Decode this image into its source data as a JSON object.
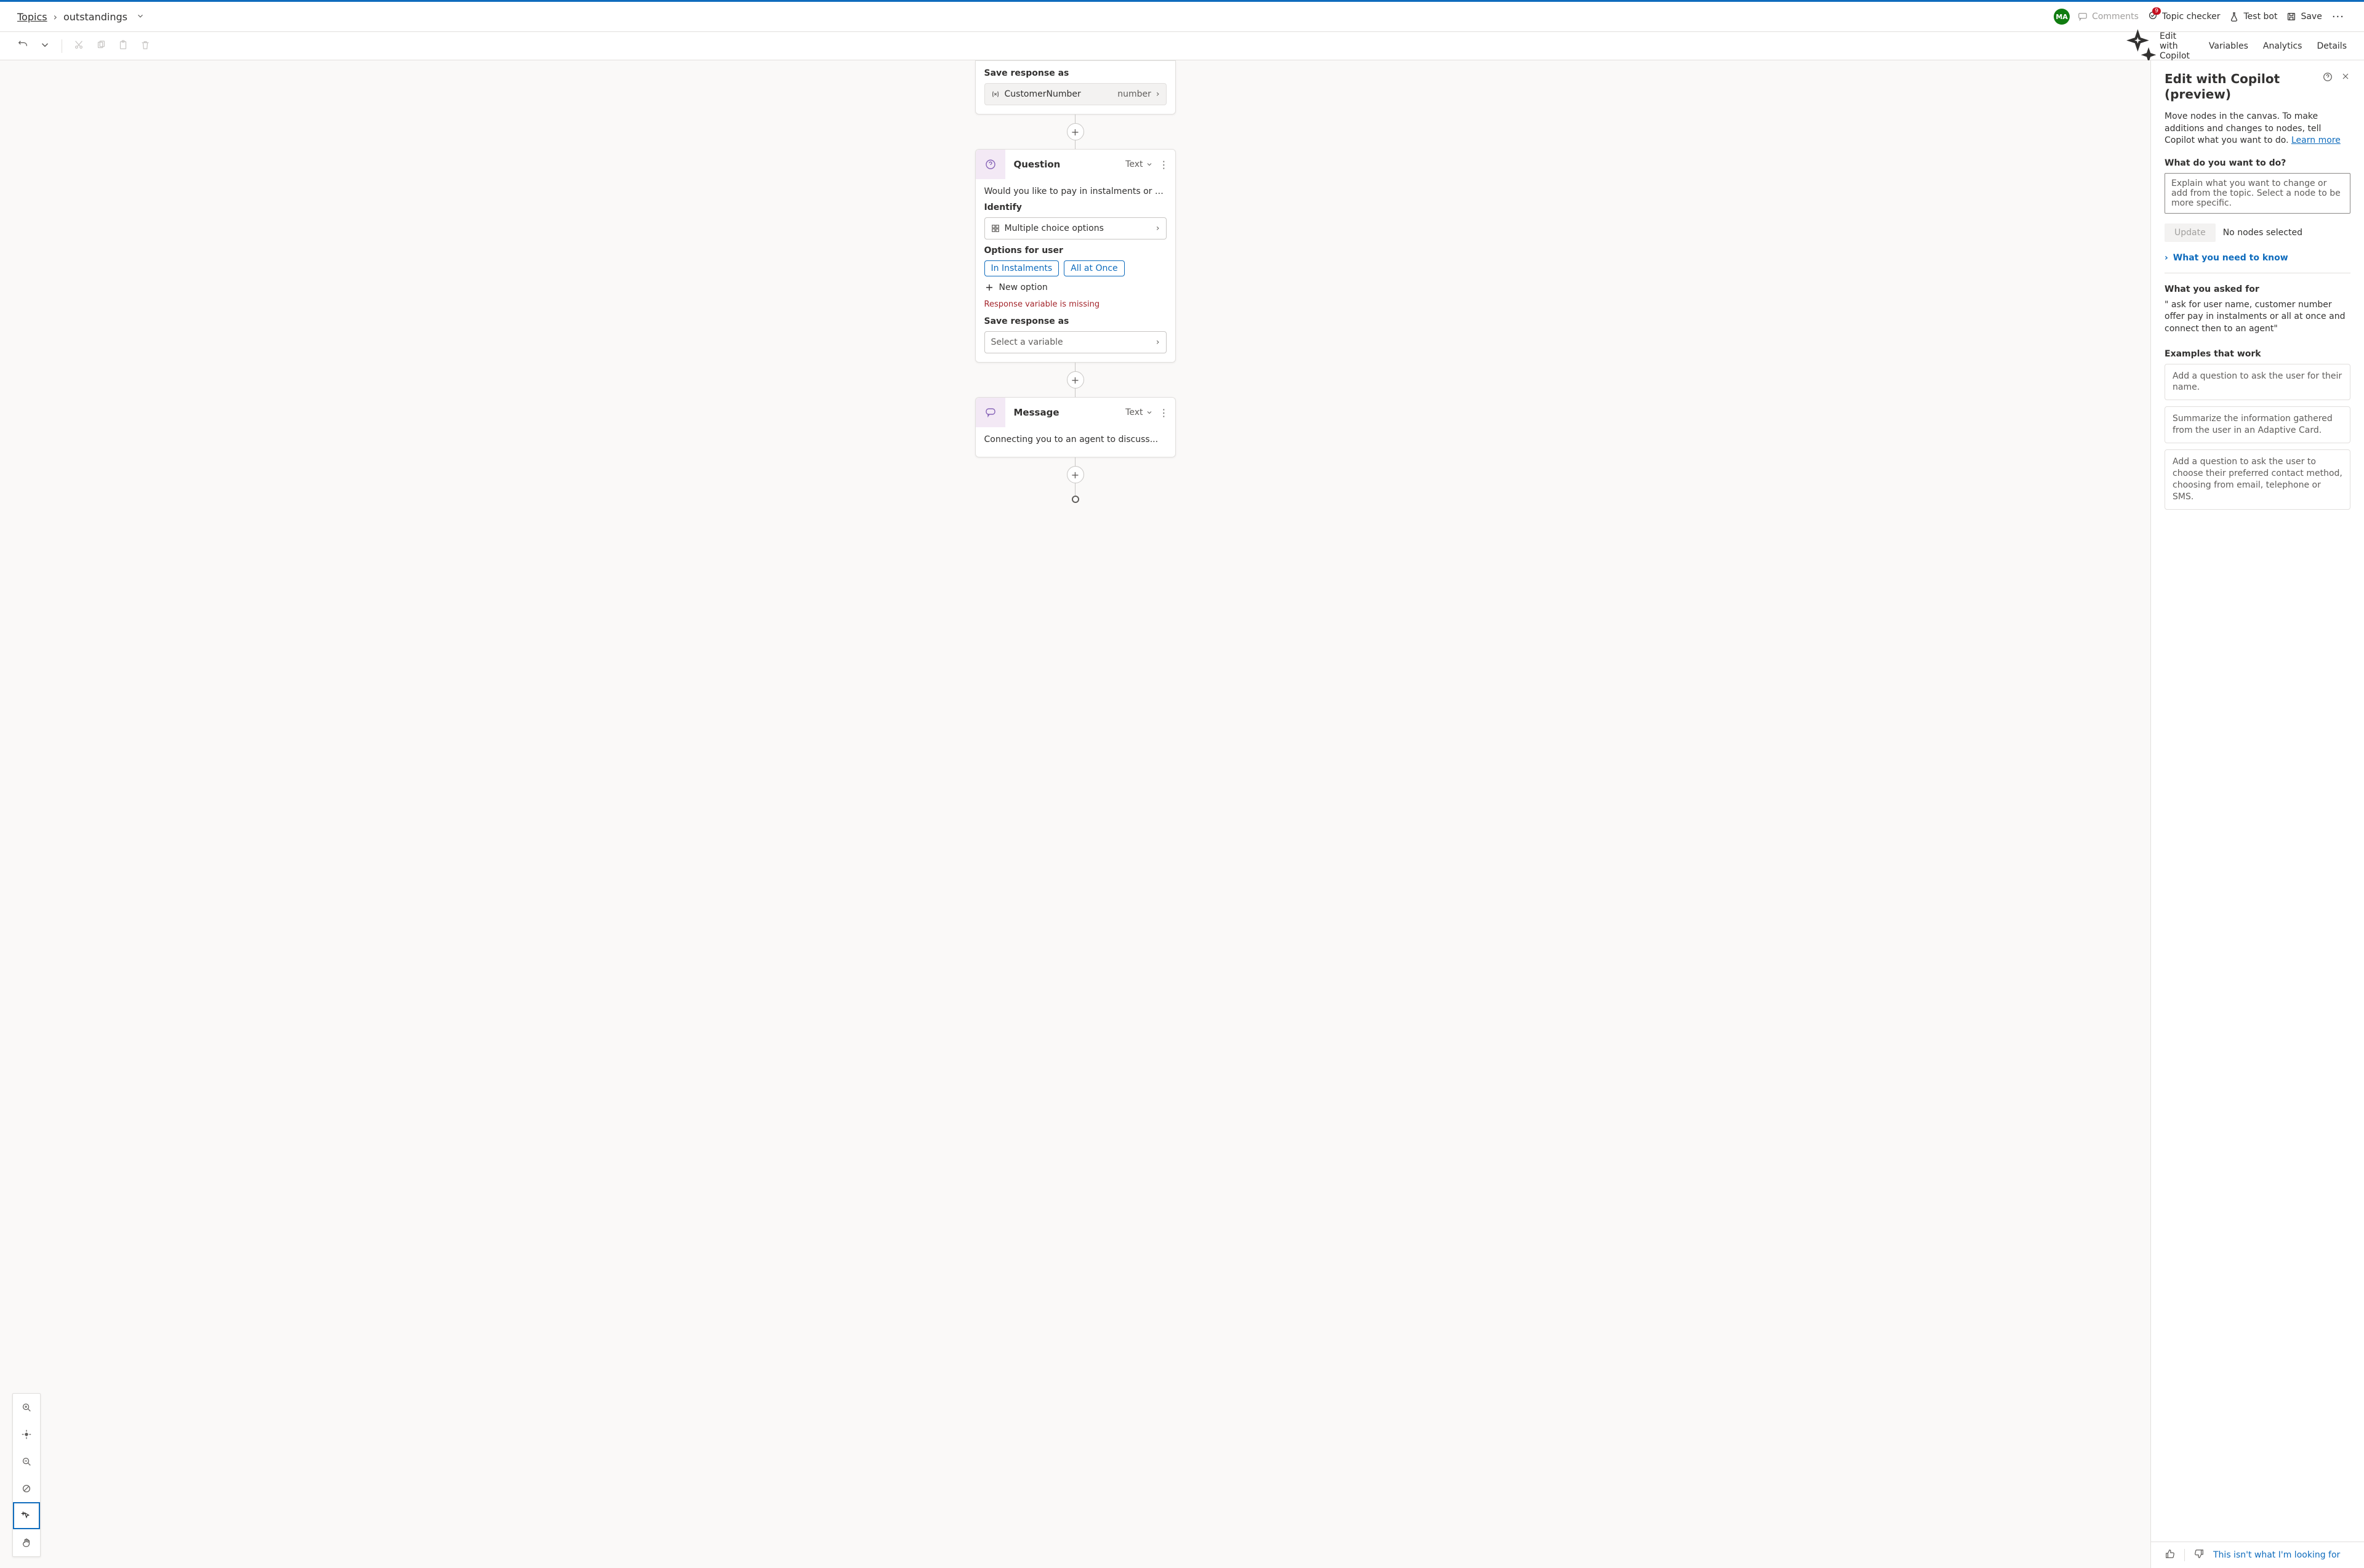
{
  "topbar": {
    "crumb_root": "Topics",
    "crumb_current": "outstandings",
    "avatar_initials": "MA",
    "comments_label": "Comments",
    "topic_checker_label": "Topic checker",
    "topic_checker_badge": "9",
    "test_bot_label": "Test bot",
    "save_label": "Save"
  },
  "toolbar": {
    "edit_copilot_label": "Edit with Copilot",
    "variables_label": "Variables",
    "analytics_label": "Analytics",
    "details_label": "Details"
  },
  "canvas": {
    "node1": {
      "save_as_label": "Save response as",
      "var_name": "CustomerNumber",
      "var_type": "number"
    },
    "node2": {
      "title": "Question",
      "type_label": "Text",
      "body_text": "Would you like to pay in instalments or all at...",
      "identify_label": "Identify",
      "identify_value": "Multiple choice options",
      "options_label": "Options for user",
      "option1": "In Instalments",
      "option2": "All at Once",
      "new_option_label": "New option",
      "error_text": "Response variable is missing",
      "save_as_label": "Save response as",
      "save_as_placeholder": "Select a variable"
    },
    "node3": {
      "title": "Message",
      "type_label": "Text",
      "body_text": "Connecting you to an agent to discuss..."
    }
  },
  "panel": {
    "title_line1": "Edit with Copilot",
    "title_line2": "(preview)",
    "lead_text": "Move nodes in the canvas. To make additions and changes to nodes, tell Copilot what you want to do. ",
    "learn_more": "Learn more",
    "prompt_label": "What do you want to do?",
    "prompt_placeholder": "Explain what you want to change or add from the topic. Select a node to be more specific.",
    "update_label": "Update",
    "update_note": "No nodes selected",
    "expander_label": "What you need to know",
    "asked_label": "What you asked for",
    "asked_text": "\" ask for user name, customer number offer pay in instalments or all at once and connect then to an agent\"",
    "examples_label": "Examples that work",
    "example1": "Add a question to ask the user for their name.",
    "example2": "Summarize the information gathered from the user in an Adaptive Card.",
    "example3": "Add a question to ask the user to choose their preferred contact method, choosing from email, telephone or SMS.",
    "feedback_link": "This isn't what I'm looking for"
  }
}
